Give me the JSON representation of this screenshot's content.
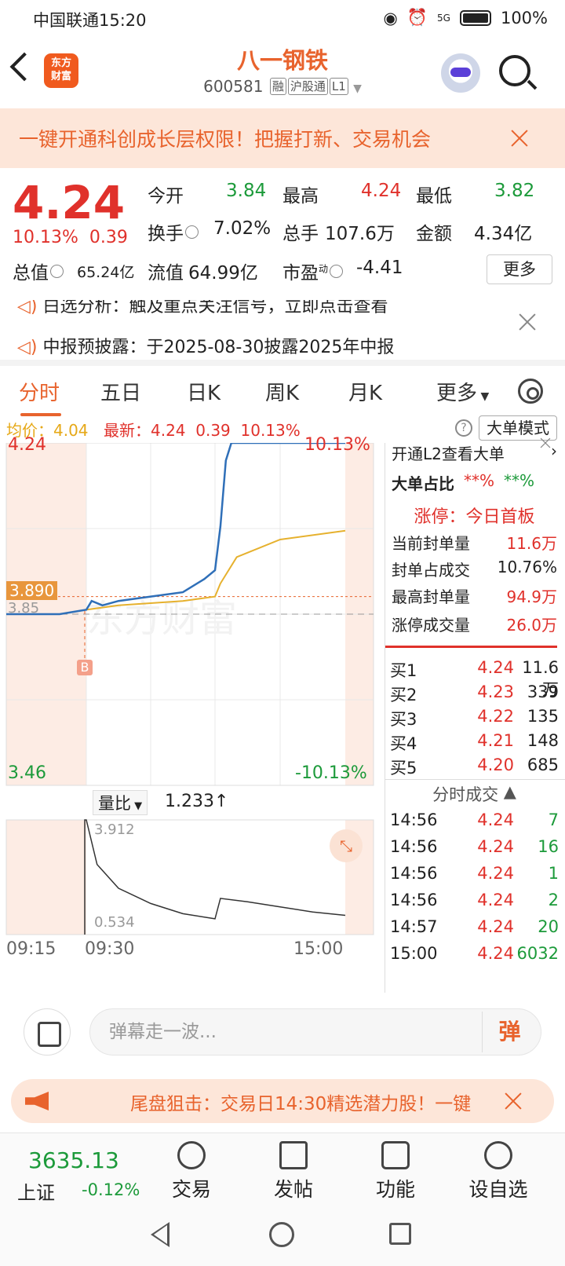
{
  "status_bar": {
    "carrier": "中国联通",
    "time": "15:20",
    "network": "5G",
    "battery": "100%"
  },
  "header": {
    "logo_line1": "东方",
    "logo_line2": "财富",
    "stock_name": "八一钢铁",
    "stock_code": "600581",
    "tags": [
      "融",
      "沪股通",
      "L1"
    ]
  },
  "banner": {
    "text": "一键开通科创成长层权限！把握打新、交易机会"
  },
  "quote": {
    "price": "4.24",
    "change_pct": "10.13%",
    "change_amt": "0.39",
    "open_label": "今开",
    "open": "3.84",
    "high_label": "最高",
    "high": "4.24",
    "low_label": "最低",
    "low": "3.82",
    "turnover_label": "换手",
    "turnover": "7.02%",
    "volume_label": "总手",
    "volume": "107.6万",
    "amount_label": "金额",
    "amount": "4.34亿",
    "mktcap_label": "总值",
    "mktcap": "65.24亿",
    "float_label": "流值",
    "float": "64.99亿",
    "pe_label": "市盈",
    "pe_sup": "动",
    "pe": "-4.41",
    "more": "更多"
  },
  "news": {
    "line1": "白选分析：触及重点关注信号，立即点击查看",
    "line2": "中报预披露：于2025-08-30披露2025年中报"
  },
  "tabs": [
    "分时",
    "五日",
    "日K",
    "周K",
    "月K",
    "更多"
  ],
  "avg_bar": {
    "avg_label": "均价：",
    "avg": "4.04",
    "latest_label": "最新：",
    "latest": "4.24",
    "chg": "0.39",
    "pct": "10.13%",
    "mode": "大单模式"
  },
  "chart": {
    "price_top": "4.24",
    "price_bottom": "3.46",
    "pct_top": "10.13%",
    "pct_bottom": "-10.13%",
    "ref_price": "3.85",
    "cursor_price": "3.890",
    "marker": "B",
    "vol_label": "量比",
    "vol_value": "1.233↑",
    "vol_top": "3.912",
    "vol_bottom": "0.534",
    "time_labels": [
      "09:15",
      "09:30",
      "15:00"
    ],
    "watermark": "东方财富"
  },
  "chart_data": {
    "type": "line",
    "series": [
      {
        "color": "#2f6fb8",
        "points": [
          [
            "09:15",
            3.85
          ],
          [
            "09:25",
            3.85
          ],
          [
            "09:30",
            3.86
          ],
          [
            "09:35",
            3.88
          ],
          [
            "09:45",
            3.87
          ],
          [
            "10:00",
            3.88
          ],
          [
            "10:30",
            3.89
          ],
          [
            "11:00",
            3.9
          ],
          [
            "11:20",
            3.93
          ],
          [
            "11:30",
            3.95
          ],
          [
            "13:05",
            4.05
          ],
          [
            "13:10",
            4.2
          ],
          [
            "13:15",
            4.24
          ],
          [
            "15:00",
            4.24
          ]
        ]
      },
      {
        "color": "#e6b12e",
        "points": [
          [
            "09:30",
            3.86
          ],
          [
            "10:00",
            3.87
          ],
          [
            "11:00",
            3.88
          ],
          [
            "11:30",
            3.89
          ],
          [
            "13:05",
            3.92
          ],
          [
            "13:20",
            3.98
          ],
          [
            "14:00",
            4.02
          ],
          [
            "15:00",
            4.04
          ]
        ]
      }
    ],
    "ylim": [
      3.46,
      4.24
    ],
    "grid": true
  },
  "panel": {
    "l2_link": "开通L2查看大单",
    "big_ratio_label": "大单占比",
    "big_ratio_buy": "**%",
    "big_ratio_sell": "**%",
    "limit_label": "涨停：",
    "limit_value": "今日首板",
    "rows": [
      {
        "k": "当前封单量",
        "v": "11.6万"
      },
      {
        "k": "封单占成交",
        "v": "10.76%"
      },
      {
        "k": "最高封单量",
        "v": "94.9万"
      },
      {
        "k": "涨停成交量",
        "v": "26.0万"
      }
    ],
    "bids": [
      {
        "label": "买1",
        "price": "4.24",
        "vol": "11.6万"
      },
      {
        "label": "买2",
        "price": "4.23",
        "vol": "339"
      },
      {
        "label": "买3",
        "price": "4.22",
        "vol": "135"
      },
      {
        "label": "买4",
        "price": "4.21",
        "vol": "148"
      },
      {
        "label": "买5",
        "price": "4.20",
        "vol": "685"
      }
    ],
    "trades_title": "分时成交",
    "trades": [
      {
        "t": "14:56",
        "p": "4.24",
        "v": "7"
      },
      {
        "t": "14:56",
        "p": "4.24",
        "v": "16"
      },
      {
        "t": "14:56",
        "p": "4.24",
        "v": "1"
      },
      {
        "t": "14:56",
        "p": "4.24",
        "v": "2"
      },
      {
        "t": "14:57",
        "p": "4.24",
        "v": "20"
      },
      {
        "t": "15:00",
        "p": "4.24",
        "v": "6032"
      }
    ]
  },
  "comment": {
    "placeholder": "弹幕走一波...",
    "button": "弹"
  },
  "promo": {
    "text": "尾盘狙击：交易日14:30精选潜力股！一键"
  },
  "bottom_bar": {
    "index_value": "3635.13",
    "index_name": "上证",
    "index_change": "-0.12%",
    "nav": [
      "交易",
      "发帖",
      "功能",
      "设自选"
    ]
  }
}
